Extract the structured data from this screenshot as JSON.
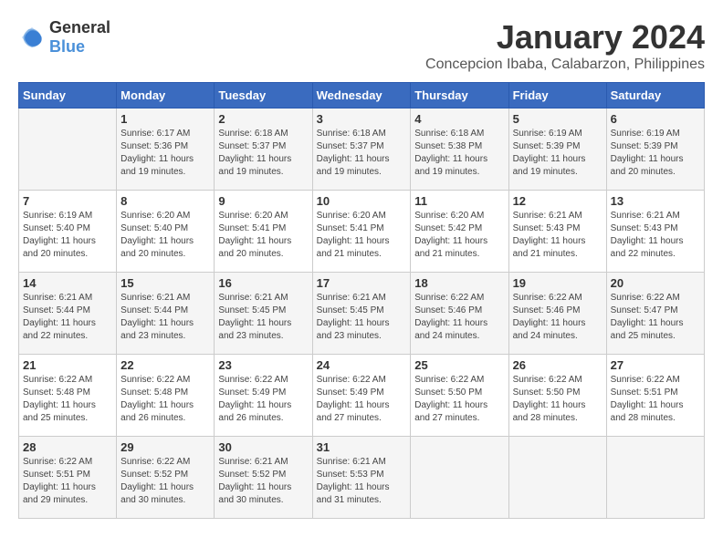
{
  "header": {
    "logo_general": "General",
    "logo_blue": "Blue",
    "month_title": "January 2024",
    "location": "Concepcion Ibaba, Calabarzon, Philippines"
  },
  "days_of_week": [
    "Sunday",
    "Monday",
    "Tuesday",
    "Wednesday",
    "Thursday",
    "Friday",
    "Saturday"
  ],
  "weeks": [
    [
      {
        "day": "",
        "info": ""
      },
      {
        "day": "1",
        "info": "Sunrise: 6:17 AM\nSunset: 5:36 PM\nDaylight: 11 hours\nand 19 minutes."
      },
      {
        "day": "2",
        "info": "Sunrise: 6:18 AM\nSunset: 5:37 PM\nDaylight: 11 hours\nand 19 minutes."
      },
      {
        "day": "3",
        "info": "Sunrise: 6:18 AM\nSunset: 5:37 PM\nDaylight: 11 hours\nand 19 minutes."
      },
      {
        "day": "4",
        "info": "Sunrise: 6:18 AM\nSunset: 5:38 PM\nDaylight: 11 hours\nand 19 minutes."
      },
      {
        "day": "5",
        "info": "Sunrise: 6:19 AM\nSunset: 5:39 PM\nDaylight: 11 hours\nand 19 minutes."
      },
      {
        "day": "6",
        "info": "Sunrise: 6:19 AM\nSunset: 5:39 PM\nDaylight: 11 hours\nand 20 minutes."
      }
    ],
    [
      {
        "day": "7",
        "info": "Sunrise: 6:19 AM\nSunset: 5:40 PM\nDaylight: 11 hours\nand 20 minutes."
      },
      {
        "day": "8",
        "info": "Sunrise: 6:20 AM\nSunset: 5:40 PM\nDaylight: 11 hours\nand 20 minutes."
      },
      {
        "day": "9",
        "info": "Sunrise: 6:20 AM\nSunset: 5:41 PM\nDaylight: 11 hours\nand 20 minutes."
      },
      {
        "day": "10",
        "info": "Sunrise: 6:20 AM\nSunset: 5:41 PM\nDaylight: 11 hours\nand 21 minutes."
      },
      {
        "day": "11",
        "info": "Sunrise: 6:20 AM\nSunset: 5:42 PM\nDaylight: 11 hours\nand 21 minutes."
      },
      {
        "day": "12",
        "info": "Sunrise: 6:21 AM\nSunset: 5:43 PM\nDaylight: 11 hours\nand 21 minutes."
      },
      {
        "day": "13",
        "info": "Sunrise: 6:21 AM\nSunset: 5:43 PM\nDaylight: 11 hours\nand 22 minutes."
      }
    ],
    [
      {
        "day": "14",
        "info": "Sunrise: 6:21 AM\nSunset: 5:44 PM\nDaylight: 11 hours\nand 22 minutes."
      },
      {
        "day": "15",
        "info": "Sunrise: 6:21 AM\nSunset: 5:44 PM\nDaylight: 11 hours\nand 23 minutes."
      },
      {
        "day": "16",
        "info": "Sunrise: 6:21 AM\nSunset: 5:45 PM\nDaylight: 11 hours\nand 23 minutes."
      },
      {
        "day": "17",
        "info": "Sunrise: 6:21 AM\nSunset: 5:45 PM\nDaylight: 11 hours\nand 23 minutes."
      },
      {
        "day": "18",
        "info": "Sunrise: 6:22 AM\nSunset: 5:46 PM\nDaylight: 11 hours\nand 24 minutes."
      },
      {
        "day": "19",
        "info": "Sunrise: 6:22 AM\nSunset: 5:46 PM\nDaylight: 11 hours\nand 24 minutes."
      },
      {
        "day": "20",
        "info": "Sunrise: 6:22 AM\nSunset: 5:47 PM\nDaylight: 11 hours\nand 25 minutes."
      }
    ],
    [
      {
        "day": "21",
        "info": "Sunrise: 6:22 AM\nSunset: 5:48 PM\nDaylight: 11 hours\nand 25 minutes."
      },
      {
        "day": "22",
        "info": "Sunrise: 6:22 AM\nSunset: 5:48 PM\nDaylight: 11 hours\nand 26 minutes."
      },
      {
        "day": "23",
        "info": "Sunrise: 6:22 AM\nSunset: 5:49 PM\nDaylight: 11 hours\nand 26 minutes."
      },
      {
        "day": "24",
        "info": "Sunrise: 6:22 AM\nSunset: 5:49 PM\nDaylight: 11 hours\nand 27 minutes."
      },
      {
        "day": "25",
        "info": "Sunrise: 6:22 AM\nSunset: 5:50 PM\nDaylight: 11 hours\nand 27 minutes."
      },
      {
        "day": "26",
        "info": "Sunrise: 6:22 AM\nSunset: 5:50 PM\nDaylight: 11 hours\nand 28 minutes."
      },
      {
        "day": "27",
        "info": "Sunrise: 6:22 AM\nSunset: 5:51 PM\nDaylight: 11 hours\nand 28 minutes."
      }
    ],
    [
      {
        "day": "28",
        "info": "Sunrise: 6:22 AM\nSunset: 5:51 PM\nDaylight: 11 hours\nand 29 minutes."
      },
      {
        "day": "29",
        "info": "Sunrise: 6:22 AM\nSunset: 5:52 PM\nDaylight: 11 hours\nand 30 minutes."
      },
      {
        "day": "30",
        "info": "Sunrise: 6:21 AM\nSunset: 5:52 PM\nDaylight: 11 hours\nand 30 minutes."
      },
      {
        "day": "31",
        "info": "Sunrise: 6:21 AM\nSunset: 5:53 PM\nDaylight: 11 hours\nand 31 minutes."
      },
      {
        "day": "",
        "info": ""
      },
      {
        "day": "",
        "info": ""
      },
      {
        "day": "",
        "info": ""
      }
    ]
  ]
}
